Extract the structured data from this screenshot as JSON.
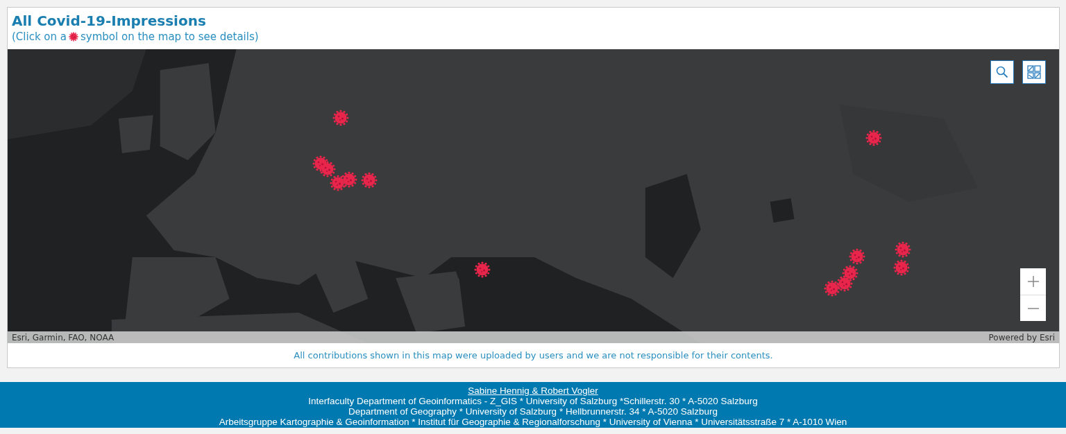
{
  "header": {
    "title": "All Covid-19-Impressions",
    "hint_before": "(Click on a",
    "hint_after": "symbol on the map to see details)"
  },
  "map": {
    "attribution": "Esri, Garmin, FAO, NOAA",
    "powered_by": "Powered by Esri"
  },
  "notice": "All contributions shown in this map were uploaded by users and we are not responsible for their contents.",
  "footer": {
    "authors": "Sabine Hennig & Robert Vogler",
    "lines": [
      "Interfaculty Department of Geoinformatics - Z_GIS * University of Salzburg *Schillerstr. 30 * A-5020 Salzburg",
      "Department of Geography * University of Salzburg * Hellbrunnerstr. 34 * A-5020 Salzburg",
      "Arbeitsgruppe Kartographie & Geoinformation * Institut für Geographie & Regionalforschung * University of Vienna * Universitätsstraße 7 * A-1010 Wien"
    ]
  }
}
